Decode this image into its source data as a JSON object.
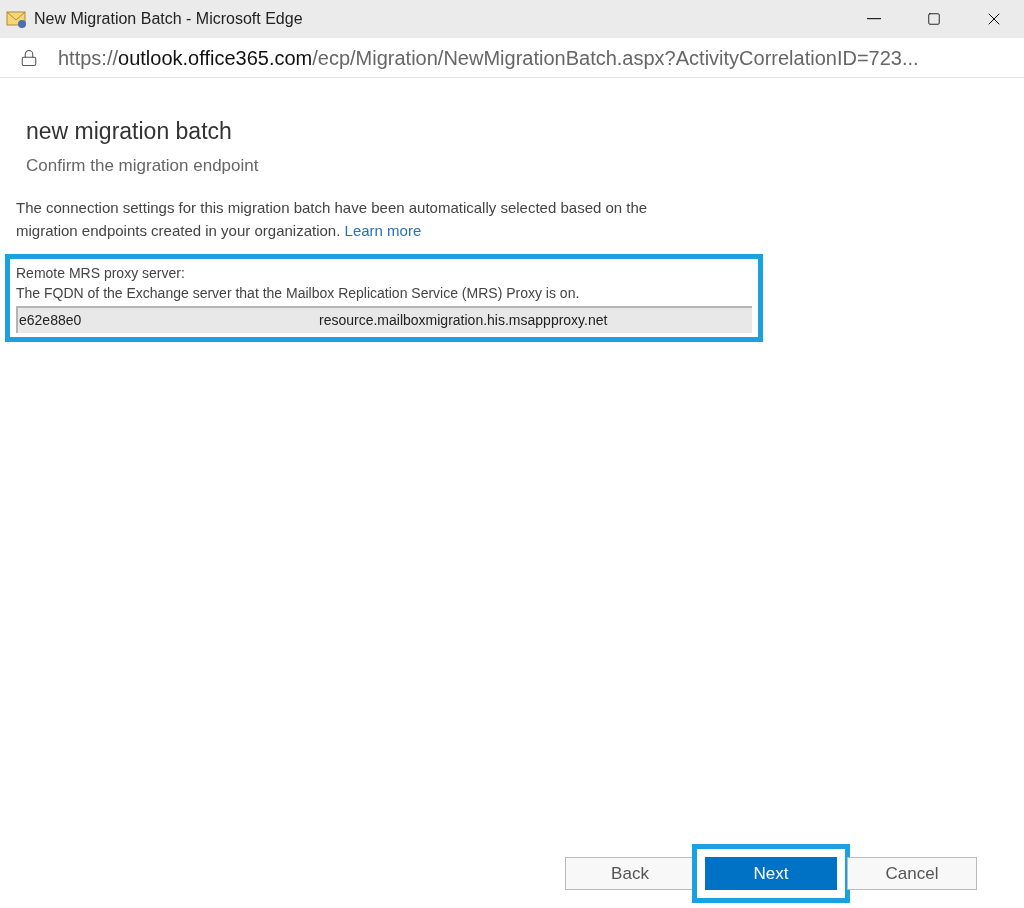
{
  "window": {
    "title": "New Migration Batch - Microsoft Edge"
  },
  "address_bar": {
    "url_scheme": "https://",
    "url_host": "outlook.office365.com",
    "url_path": "/ecp/Migration/NewMigrationBatch.aspx?ActivityCorrelationID=723..."
  },
  "page": {
    "title": "new migration batch",
    "subtitle": "Confirm the migration endpoint",
    "description": "The connection settings for this migration batch have been automatically selected based on the migration endpoints created in your organization.",
    "link": "Learn more"
  },
  "endpoint": {
    "highlighted": true,
    "label": "Remote MRS proxy server:",
    "hint": "The FQDN of the Exchange server that the Mailbox Replication Service (MRS) Proxy is on.",
    "value_parts": [
      "e62e88e0",
      "resource.mailboxmigration.his.msappproxy.net"
    ]
  },
  "buttons": [
    {
      "label": "Back",
      "kind": "secondary",
      "highlighted": false
    },
    {
      "label": "Next",
      "kind": "primary",
      "highlighted": true
    },
    {
      "label": "Cancel",
      "kind": "secondary",
      "highlighted": false
    }
  ]
}
